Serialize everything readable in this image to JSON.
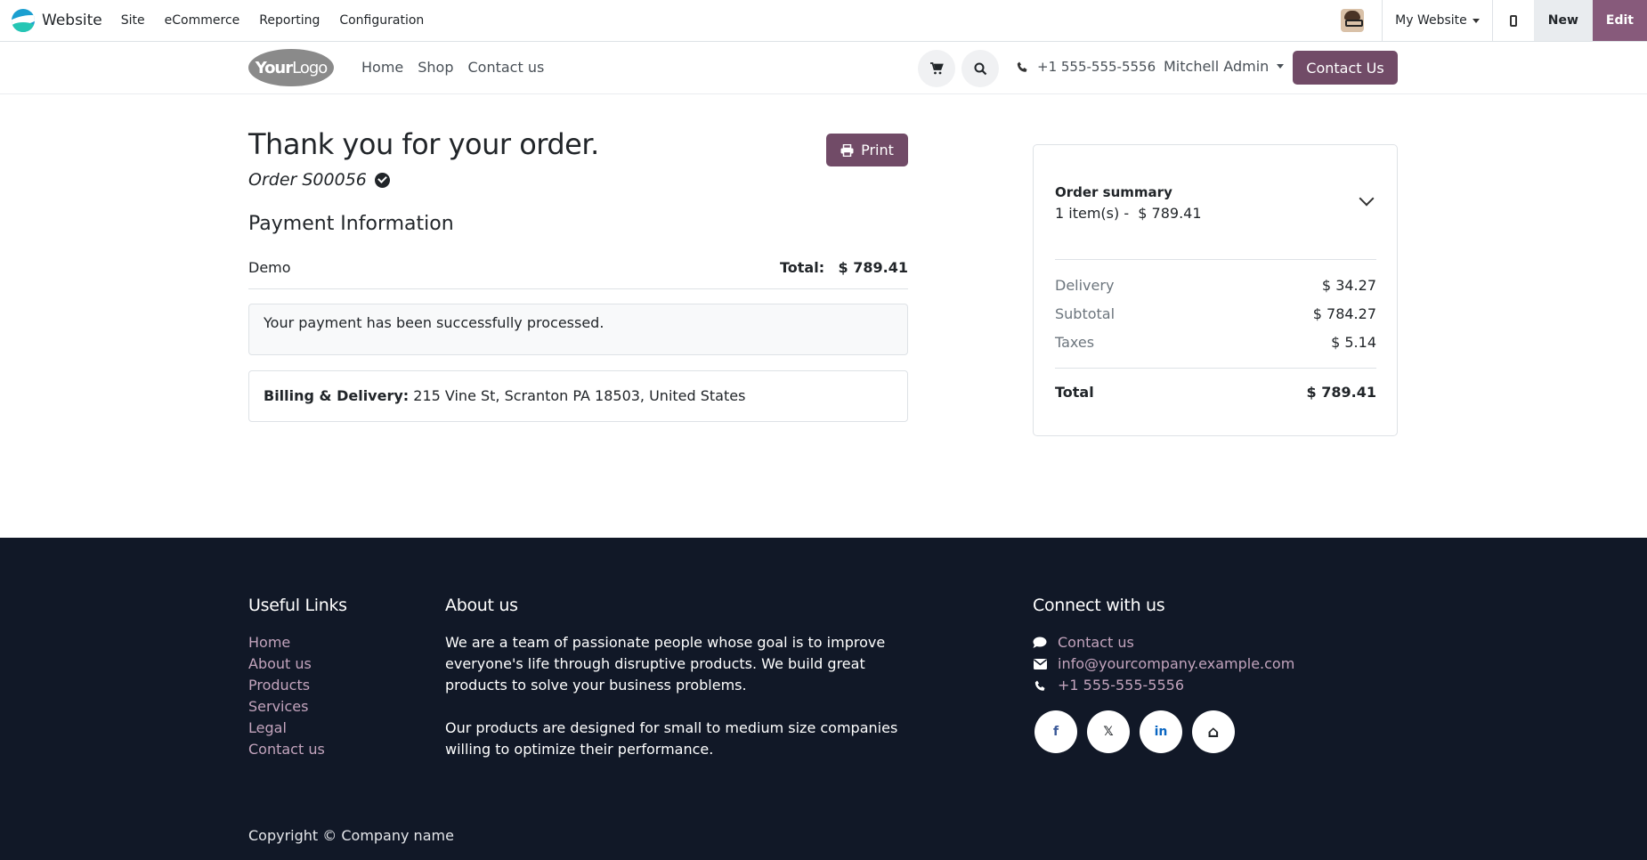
{
  "adminbar": {
    "app_name": "Website",
    "menu": [
      "Site",
      "eCommerce",
      "Reporting",
      "Configuration"
    ],
    "website_selector": "My Website",
    "new_label": "New",
    "edit_label": "Edit"
  },
  "header": {
    "logo_text_bold": "Your",
    "logo_text_light": "Logo",
    "nav": [
      "Home",
      "Shop",
      "Contact us"
    ],
    "phone": "+1 555-555-5556",
    "user": "Mitchell Admin",
    "contact_button": "Contact Us"
  },
  "confirmation": {
    "title": "Thank you for your order.",
    "order": "Order S00056",
    "print_label": "Print",
    "payment_heading": "Payment Information",
    "payment_method": "Demo",
    "total_label": "Total:",
    "total_value": "$ 789.41",
    "payment_message": "Your payment has been successfully processed.",
    "billing_label": "Billing & Delivery:",
    "billing_address": "215 Vine St, Scranton PA 18503, United States"
  },
  "summary": {
    "heading": "Order summary",
    "items_count": "1 item(s) -",
    "items_total": "$ 789.41",
    "rows": [
      {
        "label": "Delivery",
        "value": "$ 34.27"
      },
      {
        "label": "Subtotal",
        "value": "$ 784.27"
      },
      {
        "label": "Taxes",
        "value": "$ 5.14"
      }
    ],
    "total_label": "Total",
    "total_value": "$ 789.41"
  },
  "footer": {
    "useful_links_heading": "Useful Links",
    "useful_links": [
      "Home",
      "About us",
      "Products",
      "Services",
      "Legal",
      "Contact us"
    ],
    "about_heading": "About us",
    "about_p1": "We are a team of passionate people whose goal is to improve everyone's life through disruptive products. We build great products to solve your business problems.",
    "about_p2": "Our products are designed for small to medium size companies willing to optimize their performance.",
    "connect_heading": "Connect with us",
    "contact_link": "Contact us",
    "email": "info@yourcompany.example.com",
    "phone": "+1 555-555-5556",
    "socials": [
      {
        "icon": "facebook-icon",
        "glyph": "f"
      },
      {
        "icon": "x-twitter-icon",
        "glyph": "𝕏"
      },
      {
        "icon": "linkedin-icon",
        "glyph": "in"
      },
      {
        "icon": "home-icon",
        "glyph": "⌂"
      }
    ],
    "copyright": "Copyright © Company name"
  },
  "colors": {
    "brand": "#714b67",
    "edit": "#875a7b",
    "footer_bg": "#111827",
    "footer_link": "#c3a4bd"
  }
}
